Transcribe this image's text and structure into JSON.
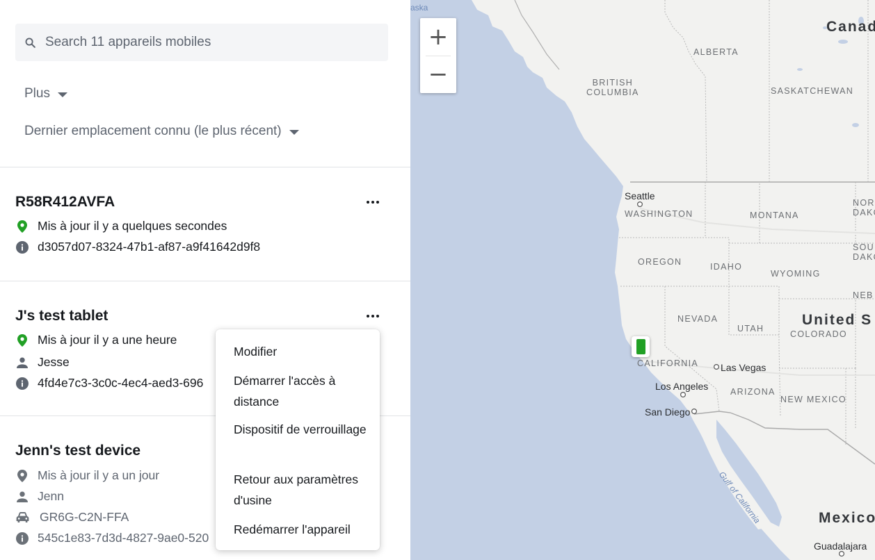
{
  "search": {
    "placeholder": "Search 11 appareils mobiles"
  },
  "filters": {
    "more_label": "Plus",
    "sort_label": "Dernier emplacement connu (le plus récent)"
  },
  "devices": [
    {
      "name": "R58R412AVFA",
      "updated": "Mis à jour il y a quelques secondes",
      "id": "d3057d07-8324-47b1-af87-a9f41642d9f8",
      "location_color": "#21a025"
    },
    {
      "name": "J's test tablet",
      "updated": "Mis à jour il y a une heure",
      "user": "Jesse",
      "id": "4fd4e7c3-3c0c-4ec4-aed3-696",
      "location_color": "#21a025"
    },
    {
      "name": "Jenn's test device",
      "updated": "Mis à jour il y a un jour",
      "user": "Jenn",
      "vehicle": "GR6G-C2N-FFA",
      "id": "545c1e83-7d3d-4827-9ae0-520",
      "location_color": "#6b7178"
    }
  ],
  "context_menu": {
    "items": [
      "Modifier",
      "Démarrer l'accès à distance",
      "Dispositif de verrouillage",
      "Retour aux paramètres d'usine",
      "Redémarrer l'appareil"
    ]
  },
  "map": {
    "zoom_in": "+",
    "zoom_out": "−",
    "countries": {
      "canada": "Canad",
      "us": "United S",
      "mexico": "Mexico",
      "alaska": "aska"
    },
    "regions": {
      "alberta": "ALBERTA",
      "bc": "BRITISH\nCOLUMBIA",
      "saskatchewan": "SASKATCHEWAN",
      "washington": "WASHINGTON",
      "montana": "MONTANA",
      "north_dakota": "NOR\nDAKO",
      "south_dakota": "SOU\nDAKO",
      "oregon": "OREGON",
      "idaho": "IDAHO",
      "wyoming": "WYOMING",
      "nebraska": "NEB",
      "nevada": "NEVADA",
      "utah": "UTAH",
      "colorado": "COLORADO",
      "california": "CALIFORNIA",
      "arizona": "ARIZONA",
      "new_mexico": "NEW MEXICO"
    },
    "cities": {
      "seattle": "Seattle",
      "las_vegas": "Las Vegas",
      "los_angeles": "Los Angeles",
      "san_diego": "San Diego",
      "guadalajara": "Guadalajara"
    },
    "water": {
      "gulf": "Gulf of California"
    },
    "marker_color": "#21a025"
  }
}
